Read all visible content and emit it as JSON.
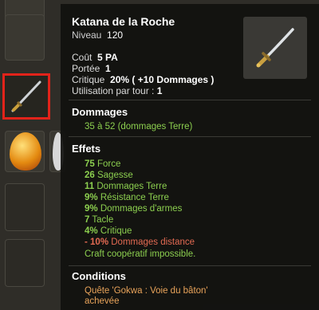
{
  "item": {
    "name": "Katana de la Roche",
    "level_label": "Niveau",
    "level_value": "120",
    "cost_label": "Coût",
    "cost_value": "5 PA",
    "range_label": "Portée",
    "range_value": "1",
    "crit_label": "Critique",
    "crit_value": "20% ( +10 Dommages )",
    "uses_label": "Utilisation par tour :",
    "uses_value": "1"
  },
  "damage": {
    "heading": "Dommages",
    "value": "35 à 52 (dommages Terre)"
  },
  "effects": {
    "heading": "Effets",
    "lines": [
      {
        "num": "75",
        "text": "Force",
        "color": "#8ccf4f"
      },
      {
        "num": "26",
        "text": "Sagesse",
        "color": "#8ccf4f"
      },
      {
        "num": "11",
        "text": "Dommages Terre",
        "color": "#8ccf4f"
      },
      {
        "num": "9%",
        "text": "Résistance Terre",
        "color": "#8ccf4f"
      },
      {
        "num": "9%",
        "text": "Dommages d'armes",
        "color": "#8ccf4f"
      },
      {
        "num": "7",
        "text": "Tacle",
        "color": "#8ccf4f"
      },
      {
        "num": "4%",
        "text": "Critique",
        "color": "#8ccf4f"
      },
      {
        "num": "- 10%",
        "text": "Dommages distance",
        "color": "#e36a52"
      }
    ],
    "craft_note": "Craft coopératif impossible."
  },
  "conditions": {
    "heading": "Conditions",
    "line1": "Quête 'Gokwa : Voie du bâton'",
    "line2": "achevée"
  },
  "icons": [
    "katana-icon",
    "dofus-egg-icon",
    "arrow-icon"
  ]
}
